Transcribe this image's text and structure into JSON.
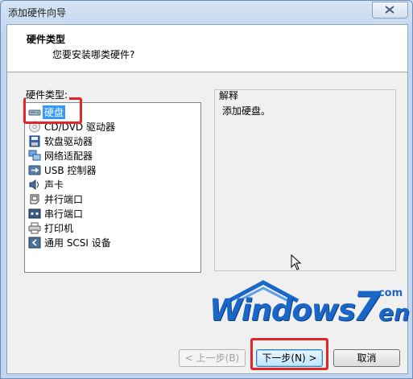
{
  "window": {
    "title": "添加硬件向导"
  },
  "header": {
    "title": "硬件类型",
    "subtitle": "您要安装哪类硬件?"
  },
  "hardware_list": {
    "label": "硬件类型:",
    "items": [
      {
        "label": "硬盘",
        "icon": "hard-disk-icon",
        "selected": true
      },
      {
        "label": "CD/DVD 驱动器",
        "icon": "cd-dvd-icon",
        "selected": false
      },
      {
        "label": "软盘驱动器",
        "icon": "floppy-drive-icon",
        "selected": false
      },
      {
        "label": "网络适配器",
        "icon": "network-adapter-icon",
        "selected": false
      },
      {
        "label": "USB 控制器",
        "icon": "usb-icon",
        "selected": false
      },
      {
        "label": "声卡",
        "icon": "sound-card-icon",
        "selected": false
      },
      {
        "label": "并行端口",
        "icon": "parallel-port-icon",
        "selected": false
      },
      {
        "label": "串行端口",
        "icon": "serial-port-icon",
        "selected": false
      },
      {
        "label": "打印机",
        "icon": "printer-icon",
        "selected": false
      },
      {
        "label": "通用 SCSI 设备",
        "icon": "scsi-device-icon",
        "selected": false
      }
    ]
  },
  "description": {
    "label": "解释",
    "text": "添加硬盘。"
  },
  "watermark": {
    "text": "Windows7en.com"
  },
  "buttons": {
    "back": "< 上一步(B)",
    "next": "下一步(N) >",
    "cancel": "取消"
  },
  "colors": {
    "selection": "#3399ff",
    "highlight_box": "#e2262a",
    "logo": "#1a67c8"
  }
}
